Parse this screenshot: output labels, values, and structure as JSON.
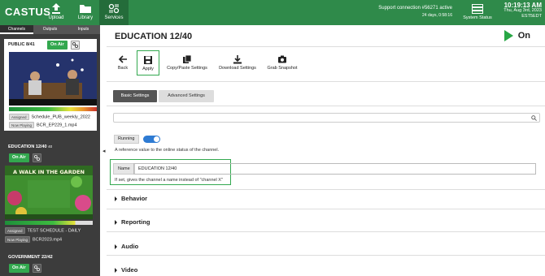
{
  "header": {
    "brand": "CASTUS",
    "nav": [
      {
        "label": "Upload",
        "icon": "upload-icon"
      },
      {
        "label": "Library",
        "icon": "folder-icon"
      },
      {
        "label": "Services",
        "icon": "services-icon"
      }
    ],
    "support": {
      "line1": "Support connection #56271 active",
      "line2": "24 days, 0:58:16"
    },
    "system_status": "System Status",
    "clock": {
      "time": "10:19:13 AM",
      "date": "Thu, Aug 3rd, 2023",
      "tz": "EST5EDT"
    },
    "colors": {
      "bar": "#2f8a4a",
      "active": "#246c3a"
    }
  },
  "sidebar": {
    "tabs": [
      "Channels",
      "Outputs",
      "Inputs"
    ],
    "channels": [
      {
        "name": "PUBLIC 8/41",
        "num": "",
        "on_air": "On Air",
        "assigned_label": "Assigned",
        "assigned": "Schedule_PUB_weekly_2022",
        "now_label": "Now Playing",
        "now": "BCR_EP229_1.mp4"
      },
      {
        "name": "EDUCATION 12/40",
        "num": "40",
        "on_air": "On Air",
        "thumb_text": "A WALK IN THE GARDEN",
        "assigned_label": "Assigned",
        "assigned": "TEST SCHEDULE - DAILY",
        "now_label": "Now Playing",
        "now": "BCR2023.mp4"
      },
      {
        "name": "GOVERNMENT 22/42",
        "num": "",
        "on_air": "On Air"
      }
    ]
  },
  "main": {
    "title": "EDUCATION 12/40",
    "status": "On",
    "toolbar": [
      {
        "label": "Back",
        "icon": "arrow-left-icon"
      },
      {
        "label": "Apply",
        "icon": "save-icon"
      },
      {
        "label": "Copy/Paste Settings",
        "icon": "copy-icon"
      },
      {
        "label": "Download Settings",
        "icon": "download-icon"
      },
      {
        "label": "Grab Snapshot",
        "icon": "camera-icon"
      }
    ],
    "subtabs": [
      "Basic Settings",
      "Advanced Settings"
    ],
    "search_placeholder": "",
    "running": {
      "label": "Running",
      "on": true,
      "help": "A reference value to the online status of the channel."
    },
    "name_field": {
      "label": "Name",
      "value": "EDUCATION 12/40",
      "help": "If set, gives the channel a name instead of \"channel X\""
    },
    "sections": [
      "Behavior",
      "Reporting",
      "Audio",
      "Video"
    ]
  }
}
